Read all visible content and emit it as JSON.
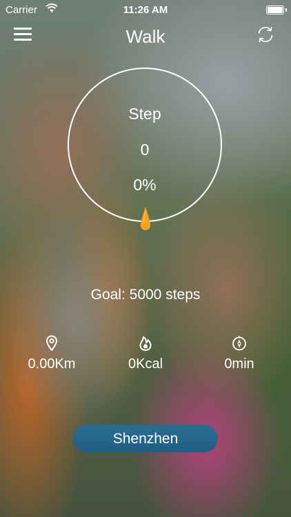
{
  "status_bar": {
    "carrier": "Carrier",
    "time": "11:26 AM",
    "icons": [
      "wifi-icon",
      "battery-icon"
    ]
  },
  "nav": {
    "title": "Walk",
    "left_icon": "menu-icon",
    "right_icon": "refresh-icon"
  },
  "ring": {
    "label": "Step",
    "count": "0",
    "percent": "0%",
    "progress": 0,
    "indicator_icon": "drop-icon",
    "indicator_color": "#f5a21c"
  },
  "goal": "Goal: 5000 steps",
  "metrics": [
    {
      "icon": "location-pin-icon",
      "value": "0.00Km"
    },
    {
      "icon": "flame-icon",
      "value": "0Kcal"
    },
    {
      "icon": "compass-icon",
      "value": "0min"
    }
  ],
  "city_button": {
    "label": "Shenzhen",
    "color": "#24668d"
  }
}
